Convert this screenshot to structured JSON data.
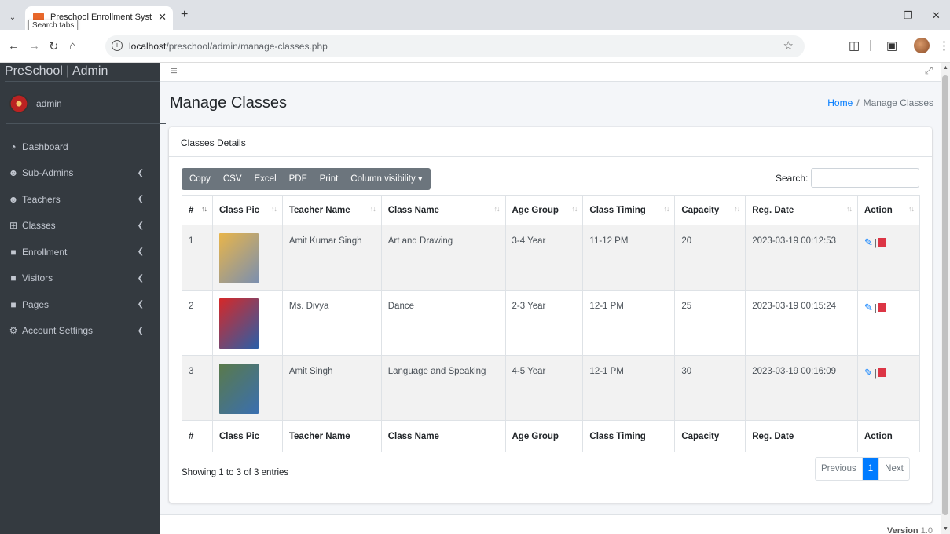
{
  "browser": {
    "tab_title": "Preschool Enrollment System | ",
    "tab_tooltip": "Search tabs",
    "url_host": "localhost",
    "url_path": "/preschool/admin/manage-classes.php"
  },
  "sidebar": {
    "brand": "PreSchool | Admin",
    "user": "admin",
    "items": [
      {
        "label": "Dashboard",
        "icon": "tachometer-icon",
        "chevron": false
      },
      {
        "label": "Sub-Admins",
        "icon": "users-icon",
        "chevron": true
      },
      {
        "label": "Teachers",
        "icon": "users-icon",
        "chevron": true
      },
      {
        "label": "Classes",
        "icon": "table-icon",
        "chevron": true
      },
      {
        "label": "Enrollment",
        "icon": "file-icon",
        "chevron": true
      },
      {
        "label": "Visitors",
        "icon": "file-icon",
        "chevron": true
      },
      {
        "label": "Pages",
        "icon": "file-icon",
        "chevron": true
      },
      {
        "label": "Account Settings",
        "icon": "user-cog-icon",
        "chevron": true
      }
    ]
  },
  "header": {
    "title": "Manage Classes",
    "breadcrumb_home": "Home",
    "breadcrumb_current": "Manage Classes"
  },
  "card": {
    "title": "Classes Details",
    "buttons": [
      "Copy",
      "CSV",
      "Excel",
      "PDF",
      "Print",
      "Column visibility ▾"
    ],
    "search_label": "Search:",
    "search_value": "",
    "columns": [
      "#",
      "Class Pic",
      "Teacher Name",
      "Class Name",
      "Age Group",
      "Class Timing",
      "Capacity",
      "Reg. Date",
      "Action"
    ],
    "rows": [
      {
        "num": "1",
        "teacher": "Amit Kumar Singh",
        "class": "Art and Drawing",
        "age": "3-4 Year",
        "timing": "11-12 PM",
        "capacity": "20",
        "reg": "2023-03-19 00:12:53",
        "pic_color_a": "#e8b54a",
        "pic_color_b": "#7a8fb0"
      },
      {
        "num": "2",
        "teacher": "Ms. Divya",
        "class": "Dance",
        "age": "2-3 Year",
        "timing": "12-1 PM",
        "capacity": "25",
        "reg": "2023-03-19 00:15:24",
        "pic_color_a": "#d62828",
        "pic_color_b": "#2a5fa8"
      },
      {
        "num": "3",
        "teacher": "Amit Singh",
        "class": "Language and Speaking",
        "age": "4-5 Year",
        "timing": "12-1 PM",
        "capacity": "30",
        "reg": "2023-03-19 00:16:09",
        "pic_color_a": "#5a7a4a",
        "pic_color_b": "#3a6fb0"
      }
    ],
    "info": "Showing 1 to 3 of 3 entries",
    "pager": {
      "prev": "Previous",
      "current": "1",
      "next": "Next"
    }
  },
  "footer": {
    "version_label": "Version",
    "version_value": "1.0"
  }
}
